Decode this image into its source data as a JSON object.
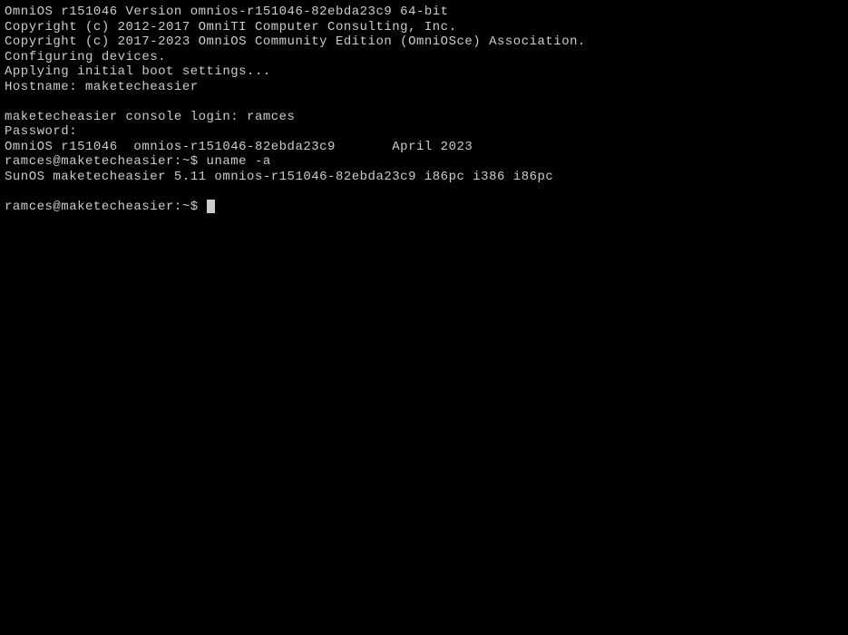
{
  "boot": {
    "version_line": "OmniOS r151046 Version omnios-r151046-82ebda23c9 64-bit",
    "copyright1": "Copyright (c) 2012-2017 OmniTI Computer Consulting, Inc.",
    "copyright2": "Copyright (c) 2017-2023 OmniOS Community Edition (OmniOSce) Association.",
    "config_devices": "Configuring devices.",
    "boot_settings": "Applying initial boot settings...",
    "hostname_line": "Hostname: maketecheasier"
  },
  "login": {
    "login_prompt": "maketecheasier console login: ",
    "login_user": "ramces",
    "password_prompt": "Password:",
    "motd": "OmniOS r151046  omnios-r151046-82ebda23c9       April 2023"
  },
  "session": {
    "prompt1": "ramces@maketecheasier:~$ ",
    "command1": "uname -a",
    "output1": "SunOS maketecheasier 5.11 omnios-r151046-82ebda23c9 i86pc i386 i86pc",
    "prompt2": "ramces@maketecheasier:~$ "
  }
}
